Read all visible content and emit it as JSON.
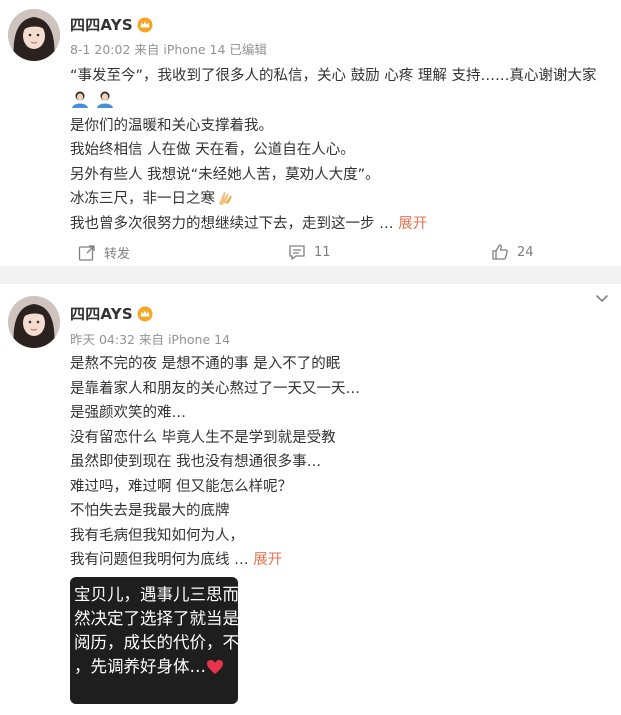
{
  "post1": {
    "user_name": "四四AYS",
    "meta": "8-1 20:02 来自 iPhone 14 已编辑",
    "lines": [
      "“事发至今”，我收到了很多人的私信，关心 鼓励 心疼 理解 支持……真心谢谢大家",
      "是你们的温暖和关心支撑着我。",
      "我始终相信 人在做 天在看，公道自在人心。",
      "另外有些人 我想说“未经她人苦，莫劝人大度”。",
      "冰冻三尺，非一日之寒",
      "我也曾多次很努力的想继续过下去，走到这一步 …"
    ],
    "expand_label": "展开",
    "actions": {
      "repost_label": "转发",
      "comment_count": "11",
      "like_count": "24"
    }
  },
  "post2": {
    "user_name": "四四AYS",
    "meta": "昨天 04:32 来自 iPhone 14",
    "lines": [
      "是熬不完的夜 是想不通的事 是入不了的眠",
      "是靠着家人和朋友的关心熬过了一天又一天…",
      "是强颜欢笑的难…",
      "没有留恋什么  毕竟人生不是学到就是受教",
      "虽然即使到现在 我也没有想通很多事…",
      "难过吗，难过啊 但又能怎么样呢？",
      "不怕失去是我最大的底牌",
      "我有毛病但我知如何为人，",
      "我有问题但我明何为底线 …"
    ],
    "expand_label": "展开",
    "image_text": [
      "宝贝儿，遇事儿三思而",
      "然决定了选择了就当是",
      "阅历，成长的代价，不",
      "，先调养好身体…"
    ]
  },
  "icons": {
    "verified": "crown-badge-icon",
    "repost": "repost-icon",
    "comment": "comment-icon",
    "like": "thumbs-up-icon",
    "more": "chevron-down-icon"
  },
  "colors": {
    "expand": "#eb7350",
    "meta": "#939393",
    "divider": "#f2f2f2"
  }
}
